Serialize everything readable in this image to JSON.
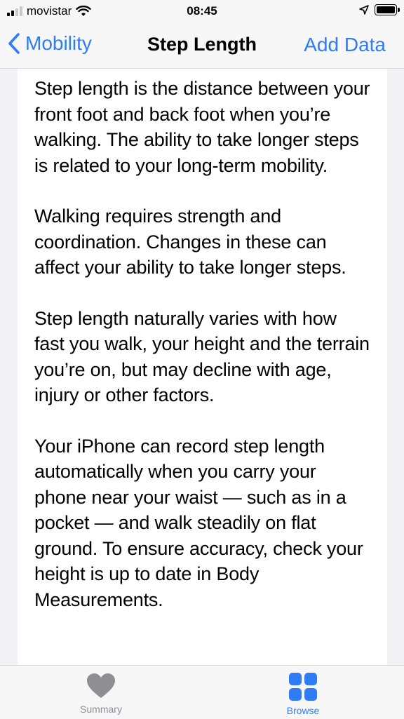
{
  "status_bar": {
    "carrier": "movistar",
    "time": "08:45"
  },
  "nav": {
    "back_label": "Mobility",
    "title": "Step Length",
    "action_label": "Add Data"
  },
  "content": {
    "paragraphs": [
      "Step length is the distance between your front foot and back foot when you’re walking. The ability to take longer steps is related to your long-term mobility.",
      "Walking requires strength and coordination. Changes in these can affect your ability to take longer steps.",
      "Step length naturally varies with how fast you walk, your height and the terrain you’re on, but may decline with age, injury or other factors.",
      "Your iPhone can record step length automatically when you carry your phone near your waist — such as in a pocket — and walk steadily on flat ground. To ensure accuracy, check your height is up to date in Body Measurements."
    ]
  },
  "tab_bar": {
    "tabs": [
      {
        "label": "Summary",
        "icon": "heart-icon",
        "active": false
      },
      {
        "label": "Browse",
        "icon": "grid-icon",
        "active": true
      }
    ]
  },
  "colors": {
    "accent": "#2f7cf6",
    "inactive": "#8e8e93",
    "background": "#f2f2f7"
  }
}
